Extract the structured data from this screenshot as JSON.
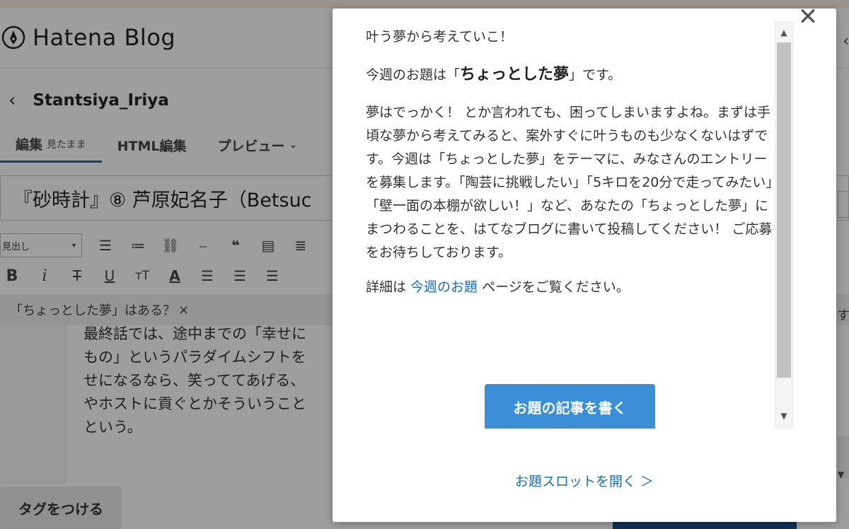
{
  "app": {
    "logo_text": "Hatena Blog"
  },
  "blog": {
    "name": "Stantsiya_Iriya"
  },
  "tabs": [
    {
      "label": "編集",
      "sub": "見たまま"
    },
    {
      "label": "HTML編集"
    },
    {
      "label": "プレビュー"
    }
  ],
  "entry": {
    "title": "『砂時計』⑧ 芦原妃名子（Betsuc",
    "body_lines": [
      "最終話では、途中までの「幸せに",
      "もの」というパラダイムシフトを",
      "せになるなら、笑っててあげる、",
      "やホストに貢ぐとかそういうこと",
      "という。"
    ]
  },
  "toolbar": {
    "heading_select": "見出し",
    "row1_icons": [
      "unordered-list-icon",
      "ordered-list-icon",
      "link-icon",
      "horizontal-rule-icon",
      "blockquote-icon",
      "table-icon",
      "more-icon"
    ],
    "row2_icons": [
      "bold-icon",
      "italic-icon",
      "strikethrough-icon",
      "underline-icon",
      "font-size-icon",
      "text-color-icon",
      "align-left-icon",
      "align-center-icon",
      "align-right-icon"
    ]
  },
  "topic_bar": {
    "text": "「ちょっとした夢」はある？",
    "close": "×"
  },
  "tag_button": "タグをつける",
  "modal": {
    "intro": "叶う夢から考えていこ！",
    "line2_pre": "今週のお題は「",
    "topic": "ちょっとした夢",
    "line2_post": "」です。",
    "paragraph": "夢はでっかく！ とか言われても、困ってしまいますよね。まずは手頃な夢から考えてみると、案外すぐに叶うものも少なくないはずです。今週は「ちょっとした夢」をテーマに、みなさんのエントリーを募集します。「陶芸に挑戦したい」「5キロを20分で走ってみたい」「壁一面の本棚が欲しい！」など、あなたの「ちょっとした夢」にまつわることを、はてなブログに書いて投稿してください！ ご応募をお待ちしております。",
    "detail_pre": "詳細は ",
    "detail_link": "今週のお題",
    "detail_post": " ページをご覧ください。",
    "cta": "お題の記事を書く",
    "slot_link": "お題スロットを開く ＞"
  },
  "colors": {
    "accent": "#1b6db5",
    "cta": "#3b8fd6",
    "overlay": "rgba(0,0,0,0.38)"
  }
}
